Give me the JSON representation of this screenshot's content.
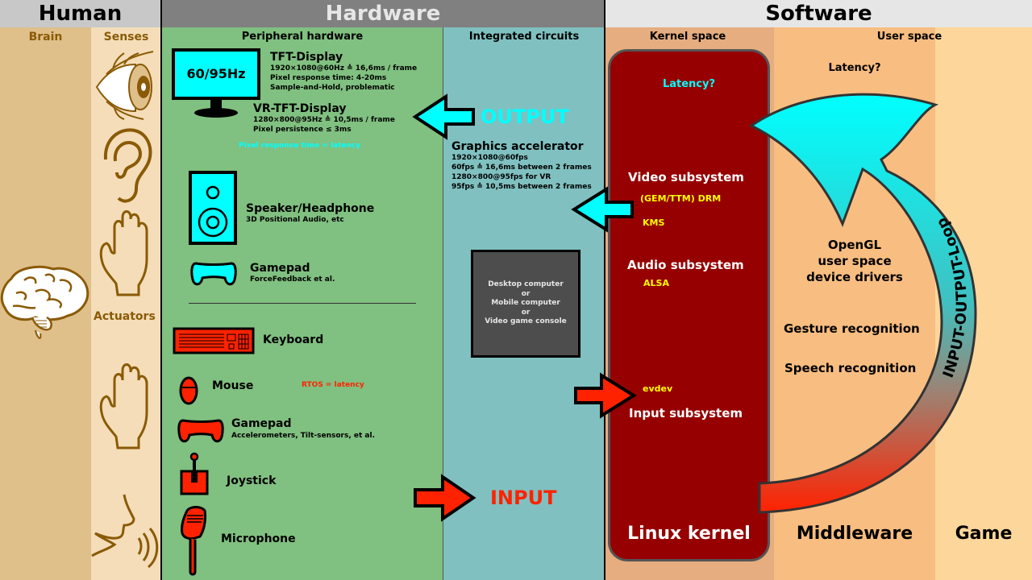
{
  "sections": {
    "human": "Human",
    "hardware": "Hardware",
    "software": "Software"
  },
  "subsections": {
    "brain": "Brain",
    "senses": "Senses",
    "actuators": "Actuators",
    "peripheral": "Peripheral hardware",
    "integrated": "Integrated circuits",
    "kernel_space": "Kernel space",
    "user_space": "User space"
  },
  "peripherals": {
    "monitor_label": "60/95Hz",
    "tft": {
      "title": "TFT-Display",
      "lines": [
        "1920×1080@60Hz ≙ 16,6ms / frame",
        "Pixel response time: 4-20ms",
        "Sample-and-Hold, problematic"
      ]
    },
    "vr": {
      "title": "VR-TFT-Display",
      "lines": [
        "1280×800@95Hz ≙ 10,5ms / frame",
        "Pixel persistence ≤ 3ms"
      ]
    },
    "pixel_note": "Pixel response time = latency",
    "speaker": {
      "title": "Speaker/Headphone",
      "sub": "3D Positional Audio, etc"
    },
    "gamepad_out": {
      "title": "Gamepad",
      "sub": "ForceFeedback et al."
    },
    "keyboard": "Keyboard",
    "mouse": "Mouse",
    "rtos_note": "RTOS = latency",
    "gamepad_in": {
      "title": "Gamepad",
      "sub": "Accelerometers, Tilt-sensors, et al."
    },
    "joystick": "Joystick",
    "microphone": "Microphone"
  },
  "integrated": {
    "output": "OUTPUT",
    "input": "INPUT",
    "gpu": {
      "title": "Graphics accelerator",
      "lines": [
        "1920×1080@60fps",
        "60fps ≙ 16,6ms between 2 frames",
        "1280×800@95fps for VR",
        "95fps ≙ 10,5ms between 2 frames"
      ]
    },
    "computer_box": [
      "Desktop computer",
      "or",
      "Mobile computer",
      "or",
      "Video game console"
    ]
  },
  "kernel": {
    "latency": "Latency?",
    "video": "Video subsystem",
    "drm": "(GEM/TTM) DRM",
    "kms": "KMS",
    "audio": "Audio subsystem",
    "alsa": "ALSA",
    "evdev": "evdev",
    "input": "Input subsystem",
    "label": "Linux kernel"
  },
  "userspace": {
    "latency": "Latency?",
    "opengl": [
      "OpenGL",
      "user space",
      "device drivers"
    ],
    "gesture": "Gesture recognition",
    "speech": "Speech recognition",
    "loop_label": "INPUT-OUTPUT-Loop",
    "middleware": "Middleware",
    "game": "Game"
  },
  "colors": {
    "human_header": "#c8c8c8",
    "hardware_header": "#808080",
    "software_header": "#e6e6e6",
    "brain_bg": "#dfbf8a",
    "senses_bg": "#f4ddb8",
    "peripheral_bg": "#80c080",
    "integrated_bg": "#80c0c0",
    "kernel_space_bg": "#e6ad80",
    "middleware_bg": "#f8bd80",
    "game_bg": "#fdd69b",
    "kernel_box": "#960000",
    "cyan": "#00ffff",
    "red": "#ff2200",
    "yellow": "#ffff00",
    "brown": "#8a5a06"
  }
}
